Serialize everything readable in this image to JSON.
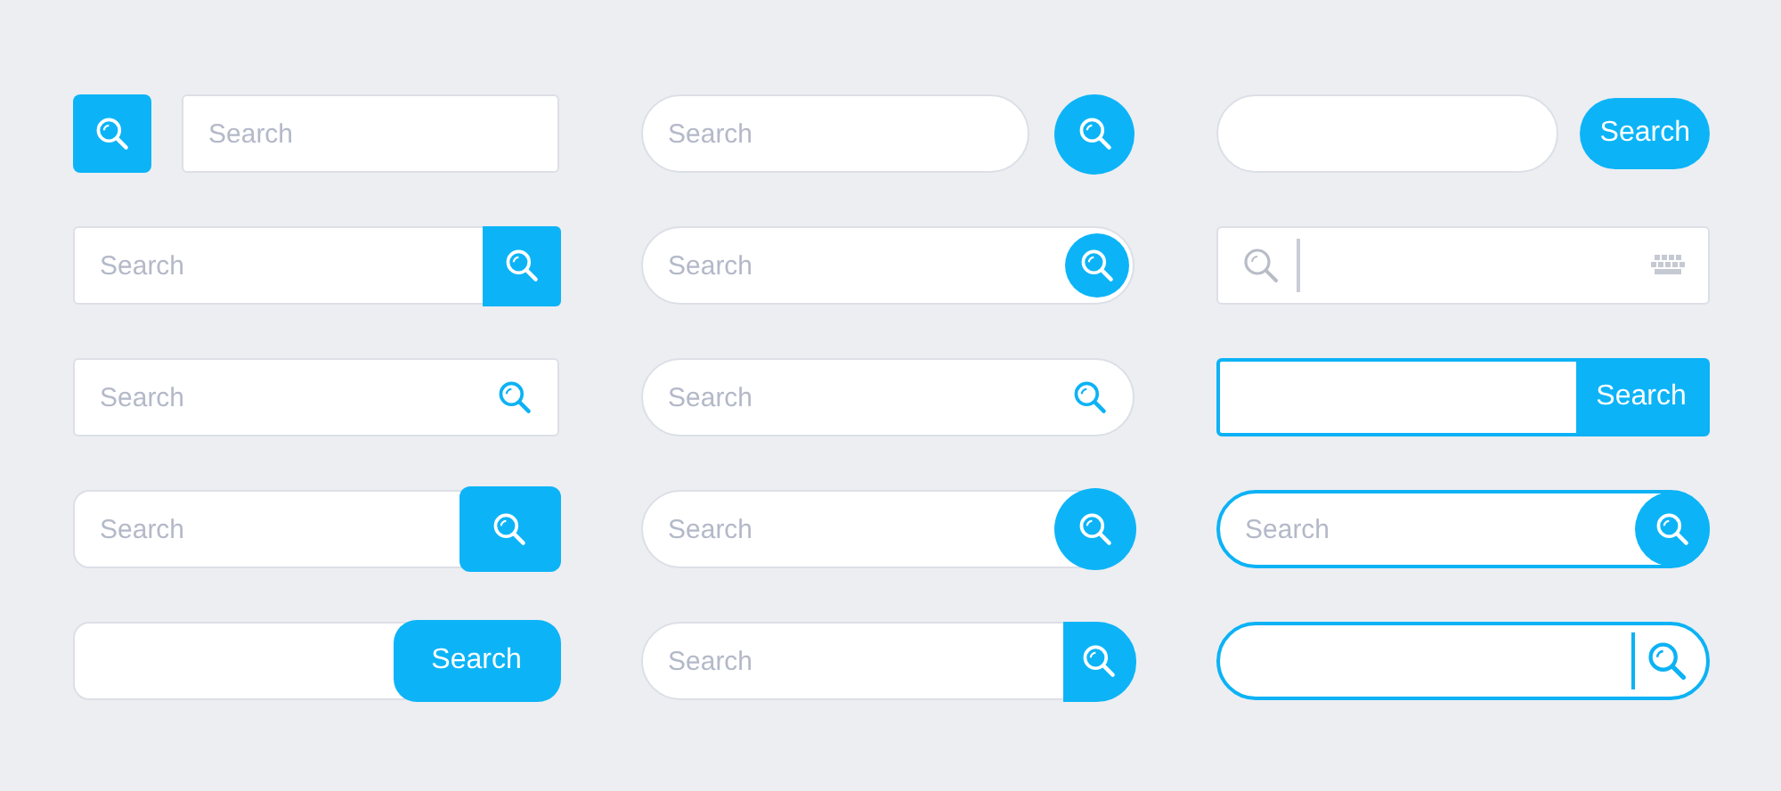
{
  "bars": [
    {
      "kind": "rect",
      "outlined": false,
      "placeholder": "Search",
      "button": {
        "kind": "lead-square"
      }
    },
    {
      "kind": "pill",
      "outlined": false,
      "placeholder": "Search",
      "button": {
        "kind": "trailing-circle"
      }
    },
    {
      "kind": "pill",
      "outlined": false,
      "button": {
        "kind": "trailing-pill",
        "label": "Search"
      }
    },
    {
      "kind": "rect",
      "outlined": false,
      "placeholder": "Search",
      "button": {
        "kind": "attached-square"
      }
    },
    {
      "kind": "pill",
      "outlined": false,
      "placeholder": "Search",
      "button": {
        "kind": "inner-circle"
      }
    },
    {
      "kind": "rect",
      "outlined": false,
      "keyboard": true,
      "button": {
        "kind": "cursor"
      }
    },
    {
      "kind": "rect",
      "outlined": false,
      "placeholder": "Search",
      "button": {
        "kind": "icon"
      }
    },
    {
      "kind": "pill",
      "outlined": false,
      "placeholder": "Search",
      "button": {
        "kind": "icon"
      }
    },
    {
      "kind": "rect",
      "outlined": true,
      "button": {
        "kind": "attached-square",
        "label": "Search"
      }
    },
    {
      "kind": "round",
      "outlined": false,
      "placeholder": "Search",
      "button": {
        "kind": "overlap-round"
      }
    },
    {
      "kind": "pill",
      "outlined": false,
      "placeholder": "Search",
      "button": {
        "kind": "overlap-circle"
      }
    },
    {
      "kind": "pill",
      "outlined": true,
      "placeholder": "Search",
      "button": {
        "kind": "inner-circle"
      }
    },
    {
      "kind": "round",
      "outlined": false,
      "button": {
        "kind": "overlap-round",
        "label": "Search"
      }
    },
    {
      "kind": "pill",
      "outlined": false,
      "placeholder": "Search",
      "button": {
        "kind": "attached-half"
      }
    },
    {
      "kind": "pill",
      "outlined": true,
      "button": {
        "kind": "divider"
      }
    }
  ]
}
